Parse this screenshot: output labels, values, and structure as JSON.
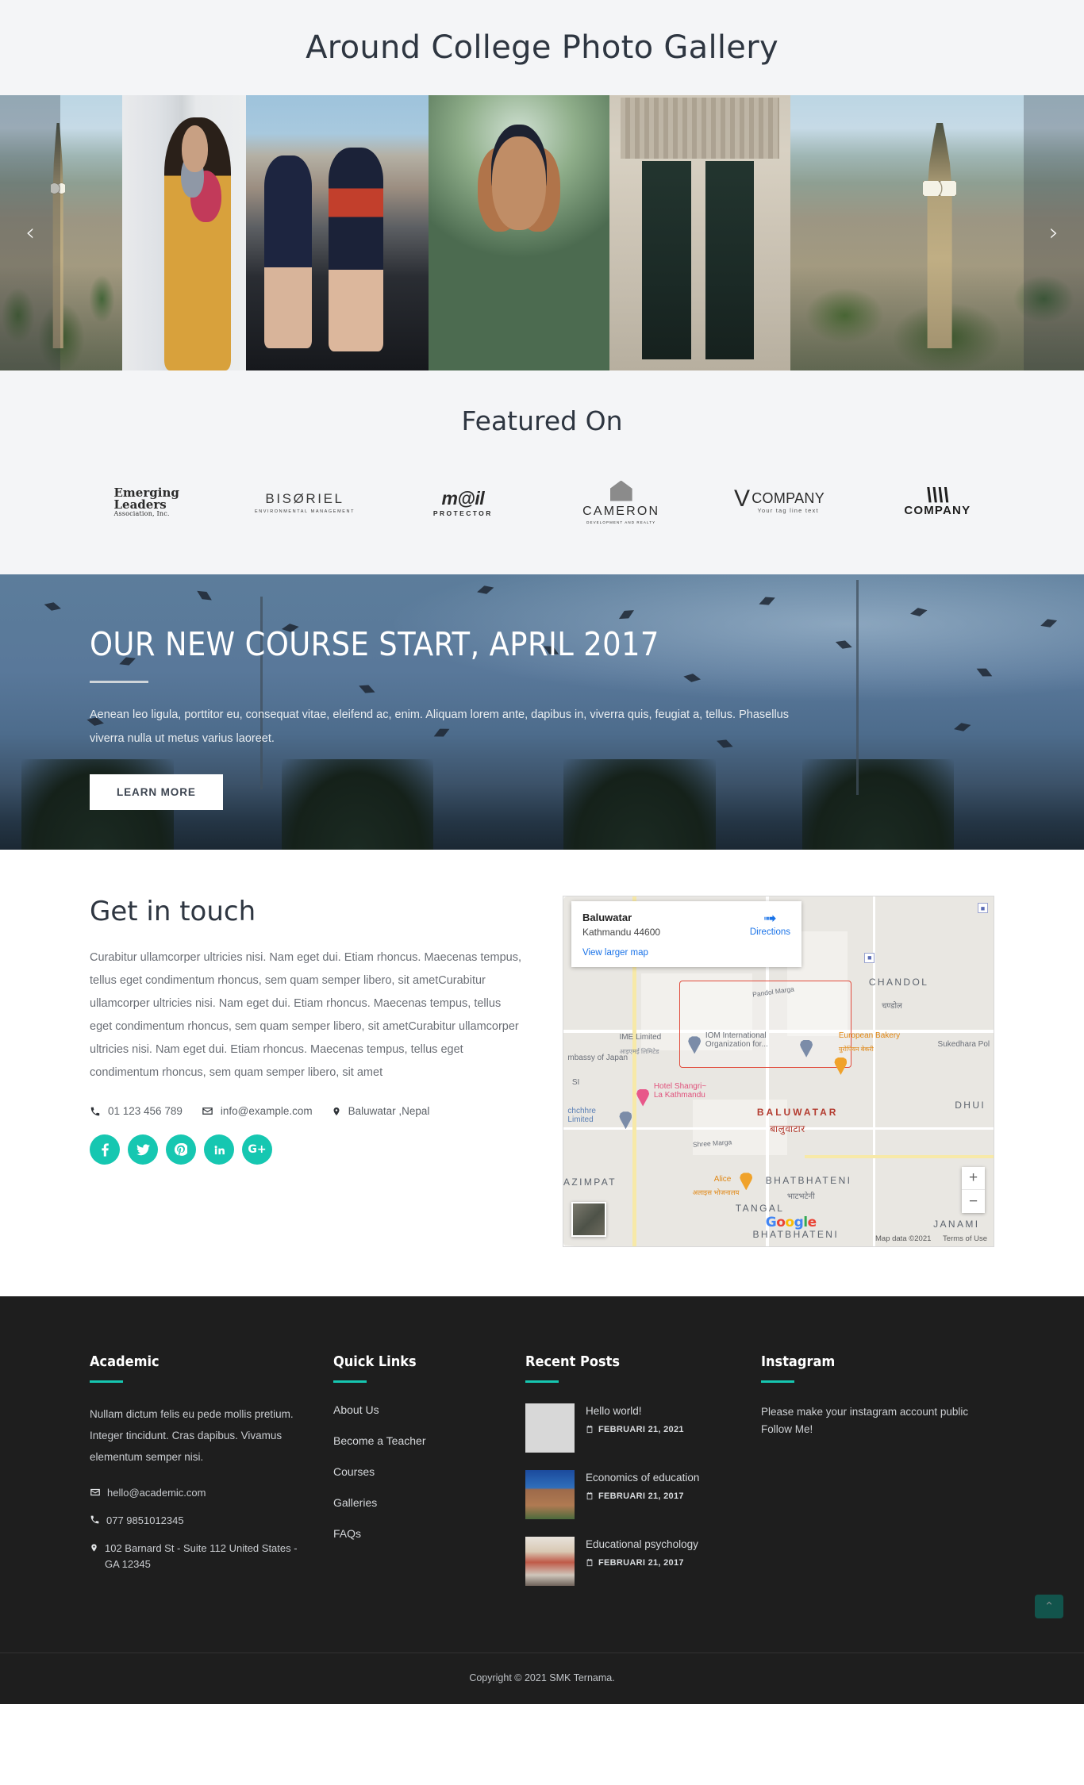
{
  "header": {
    "title": "Around College Photo Gallery"
  },
  "carousel": {
    "prev_label": "‹",
    "next_label": "›",
    "slides": [
      {
        "alt": "big-ben-cityscape"
      },
      {
        "alt": "student-in-yellow-coat"
      },
      {
        "alt": "graduates-celebrating-with-champagne"
      },
      {
        "alt": "smiling-graduate-in-red-floral-dress"
      },
      {
        "alt": "cathedral-bronze-doors"
      },
      {
        "alt": "big-ben-cityscape"
      }
    ]
  },
  "featured": {
    "title": "Featured On",
    "logos": [
      {
        "name": "Emerging Leaders",
        "line1": "Emerging",
        "line2": "Leaders",
        "sub": "Association, Inc."
      },
      {
        "name": "BISORIEL",
        "line1": "BISØRIEL",
        "sub": "ENVIRONMENTAL MANAGEMENT"
      },
      {
        "name": "m@il PROTECTOR",
        "line1": "m@il",
        "sub": "PROTECTOR"
      },
      {
        "name": "CAMERON",
        "line1": "CAMERON",
        "sub": "DEVELOPMENT AND REALTY"
      },
      {
        "name": "V COMPANY",
        "line1": "COMPANY",
        "sub": "Your tag line text"
      },
      {
        "name": "COMPANY",
        "line1": "COMPANY"
      }
    ]
  },
  "cta": {
    "heading": "OUR NEW COURSE START, APRIL 2017",
    "body": "Aenean leo ligula, porttitor eu, consequat vitae, eleifend ac, enim. Aliquam lorem ante, dapibus in, viverra quis, feugiat a, tellus. Phasellus viverra nulla ut metus varius laoreet.",
    "button": "LEARN MORE"
  },
  "contact": {
    "title": "Get in touch",
    "body": "Curabitur ullamcorper ultricies nisi. Nam eget dui. Etiam rhoncus. Maecenas tempus, tellus eget condimentum rhoncus, sem quam semper libero, sit ametCurabitur ullamcorper ultricies nisi. Nam eget dui. Etiam rhoncus. Maecenas tempus, tellus eget condimentum rhoncus, sem quam semper libero, sit ametCurabitur ullamcorper ultricies nisi. Nam eget dui. Etiam rhoncus. Maecenas tempus, tellus eget condimentum rhoncus, sem quam semper libero, sit amet",
    "phone": "01 123 456 789",
    "email": "info@example.com",
    "address": "Baluwatar ,Nepal",
    "accent_color": "#16c7b1",
    "socials": [
      {
        "name": "facebook",
        "glyph": "f"
      },
      {
        "name": "twitter",
        "glyph": "t"
      },
      {
        "name": "pinterest",
        "glyph": "p"
      },
      {
        "name": "linkedin",
        "glyph": "in"
      },
      {
        "name": "google-plus",
        "glyph": "G+"
      }
    ]
  },
  "map": {
    "card_title": "Baluwatar",
    "card_subtitle": "Kathmandu 44600",
    "directions_label": "Directions",
    "view_larger": "View larger map",
    "zoom_in": "+",
    "zoom_out": "−",
    "brand": "Google",
    "attribution": "Map data ©2021",
    "terms": "Terms of Use",
    "labels": [
      "CHANDOL",
      "चण्डोल",
      "IME Limited",
      "आइएमई लिमिटेड",
      "IOM International Organization for...",
      "European Bakery",
      "युरोपियन बेकरी",
      "Sukedhara Pol",
      "mbassy of Japan",
      "Hotel Shangri~ La Kathmandu",
      "BALUWATAR",
      "बालुवाटार",
      "chchhre Limited",
      "DHUI",
      "Shree Marga",
      "Pandol Marga",
      "AZIMPAT",
      "Alice",
      "अलाइस भोजनालय",
      "BHATBHATENI",
      "भाटभटेनी",
      "TANGAL",
      "JANAMI"
    ]
  },
  "footer": {
    "about": {
      "title": "Academic",
      "body": "Nullam dictum felis eu pede mollis pretium. Integer tincidunt. Cras dapibus. Vivamus elementum semper nisi.",
      "email": "hello@academic.com",
      "phone": "077 9851012345",
      "address": "102 Barnard St - Suite 112 United States - GA 12345"
    },
    "quick_links": {
      "title": "Quick Links",
      "items": [
        "About Us",
        "Become a Teacher",
        "Courses",
        "Galleries",
        "FAQs"
      ]
    },
    "recent_posts": {
      "title": "Recent Posts",
      "items": [
        {
          "title": "Hello world!",
          "date": "FEBRUARI 21, 2021",
          "thumb": "placeholder"
        },
        {
          "title": "Economics of education",
          "date": "FEBRUARI 21, 2017",
          "thumb": "campus-building"
        },
        {
          "title": "Educational psychology",
          "date": "FEBRUARI 21, 2017",
          "thumb": "chess-board"
        }
      ]
    },
    "instagram": {
      "title": "Instagram",
      "line1": "Please make your instagram account public",
      "line2": " Follow Me!"
    },
    "copyright": "Copyright © 2021 SMK Ternama.",
    "to_top": "⌃"
  }
}
